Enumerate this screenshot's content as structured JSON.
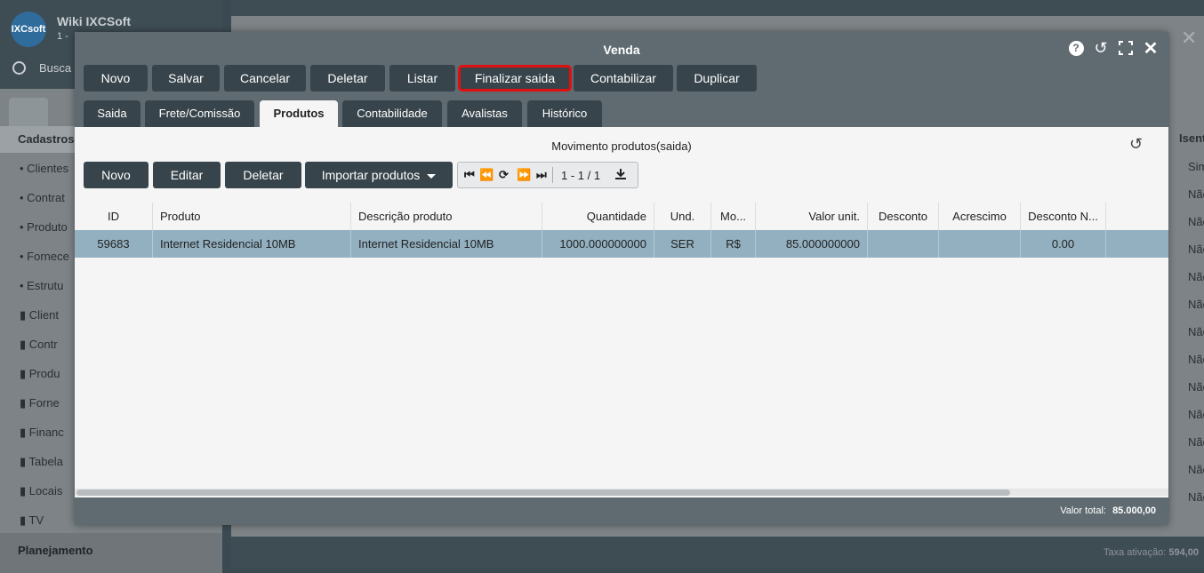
{
  "background": {
    "app_title": "Wiki IXCSoft",
    "app_sub": "1 -",
    "logo_text": "IXCsoft",
    "search_placeholder": "Busca",
    "section": "Cadastros",
    "items": [
      "Clientes",
      "Contrat",
      "Produto",
      "Fornece",
      "Estrutu"
    ],
    "folders": [
      "Client",
      "Contr",
      "Produ",
      "Forne",
      "Financ",
      "Tabela",
      "Locais",
      "TV"
    ],
    "planning": "Planejamento",
    "col_header": "Isent",
    "col_cells": [
      "Sim",
      "Não",
      "Não",
      "Não",
      "Não",
      "Não",
      "Não",
      "Não",
      "Não",
      "Não",
      "Não",
      "Não",
      "Não"
    ],
    "taxa_label": "Taxa ativação:",
    "taxa_value": "594,00"
  },
  "modal": {
    "title": "Venda",
    "toolbar": {
      "novo": "Novo",
      "salvar": "Salvar",
      "cancelar": "Cancelar",
      "deletar": "Deletar",
      "listar": "Listar",
      "finalizar": "Finalizar saida",
      "contabilizar": "Contabilizar",
      "duplicar": "Duplicar"
    },
    "tabs": [
      "Saida",
      "Frete/Comissão",
      "Produtos",
      "Contabilidade",
      "Avalistas",
      "Histórico"
    ],
    "active_tab": "Produtos",
    "grid": {
      "title": "Movimento produtos(saida)",
      "buttons": {
        "novo": "Novo",
        "editar": "Editar",
        "deletar": "Deletar",
        "importar": "Importar produtos"
      },
      "pager": "1 - 1 / 1",
      "columns": [
        "ID",
        "Produto",
        "Descrição produto",
        "Quantidade",
        "Und.",
        "Mo...",
        "Valor unit.",
        "Desconto",
        "Acrescimo",
        "Desconto N..."
      ],
      "rows": [
        [
          "59683",
          "Internet Residencial 10MB",
          "Internet Residencial 10MB",
          "1000.000000000",
          "SER",
          "R$",
          "85.000000000",
          "",
          "",
          "0.00"
        ]
      ]
    },
    "footer": {
      "label": "Valor total:",
      "value": "85.000,00"
    }
  },
  "colors": {
    "header": "#5f6b71",
    "button": "#37444b",
    "row_selected": "#92b0c0",
    "highlight_border": "#e01010"
  }
}
